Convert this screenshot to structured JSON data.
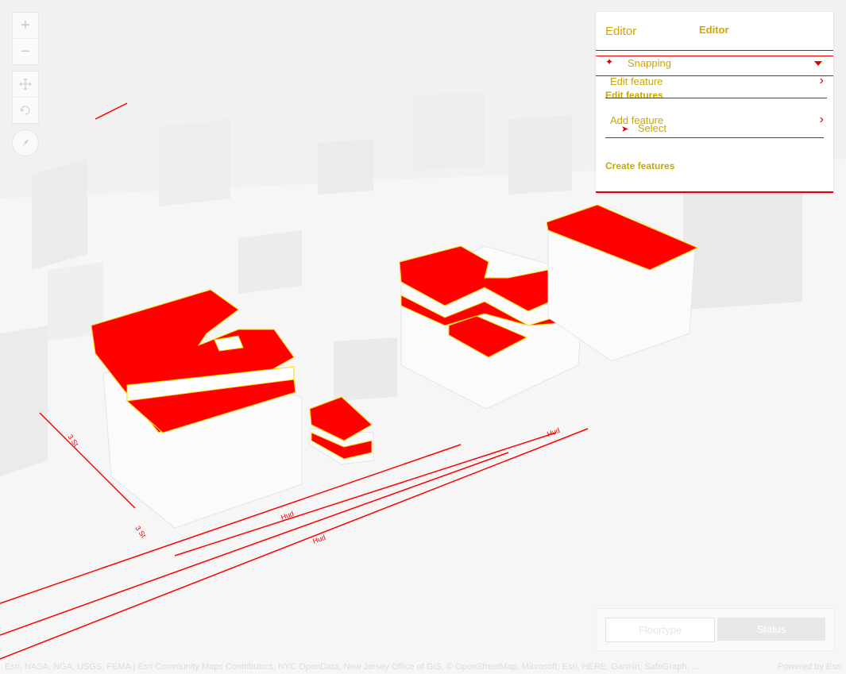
{
  "editor": {
    "title": "Editor",
    "header_label": "Editor",
    "snapping_label": "Snapping",
    "edit_feature_label": "Edit feature",
    "edit_features_heading": "Edit features",
    "add_feature_label": "Add feature",
    "select_label": "Select",
    "create_features_heading": "Create features"
  },
  "filter": {
    "floortype_label": "Floortype",
    "status_label": "Status"
  },
  "map": {
    "zoom_in_symbol": "+",
    "zoom_out_symbol": "−",
    "street_labels": [
      "3 St",
      "Hud",
      "Hud",
      "3 St",
      "Hud"
    ]
  },
  "attribution": {
    "sources": "Esri, NASA, NGA, USGS, FEMA | Esri Community Maps Contributors, NYC OpenData, New Jersey Office of GIS, © OpenStreetMap, Microsoft, Esri, HERE, Garmin, SafeGraph, ...",
    "powered_by": "Powered by Esri"
  },
  "colors": {
    "highlight": "#ff0000",
    "accent_text": "#d4a400",
    "background": "#f2f2f2"
  }
}
